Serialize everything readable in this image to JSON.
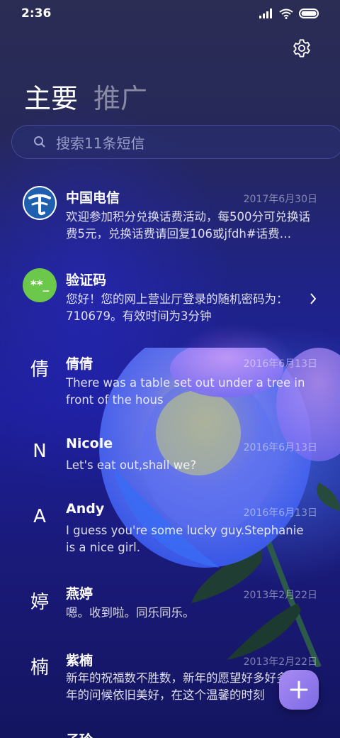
{
  "status_bar": {
    "time": "2:36"
  },
  "tabs": {
    "primary": "主要",
    "promotions": "推广"
  },
  "search": {
    "placeholder": "搜索11条短信"
  },
  "conversations": [
    {
      "sender": "中国电信",
      "date": "2017年6月30日",
      "preview": "欢迎参加积分兑换话费活动，每500分可兑换话费5元，兑换话费请回复106或jfdh#话费…",
      "avatar": "china-telecom-logo-icon"
    },
    {
      "sender": "验证码",
      "date": "",
      "preview": "您好！您的网上营业厅登录的随机密码为：710679。有效时间为3分钟",
      "avatar_text": "**_"
    },
    {
      "sender": "倩倩",
      "date": "2016年6月13日",
      "preview": "There was a table set out under a tree in front of the hous",
      "avatar_text": "倩"
    },
    {
      "sender": "Nicole",
      "date": "2016年6月13日",
      "preview": "Let's eat out,shall we?",
      "avatar_text": "N"
    },
    {
      "sender": "Andy",
      "date": "2016年6月13日",
      "preview": "I guess you're some lucky guy.Stephanie is a nice girl.",
      "avatar_text": "A"
    },
    {
      "sender": "燕婷",
      "date": "2013年2月22日",
      "preview": "嗯。收到啦。同乐同乐。",
      "avatar_text": "婷"
    },
    {
      "sender": "紫楠",
      "date": "2013年2月22日",
      "preview": "新年的祝福数不胜数，新年的愿望好多好多，新年的问候依旧美好，在这个温馨的时刻",
      "avatar_text": "楠"
    },
    {
      "sender": "子玲",
      "date": "",
      "preview": "",
      "avatar_text": ""
    }
  ],
  "colors": {
    "verification_avatar": "#6cc84a",
    "fab_accent": "#9a82ee",
    "telecom_blue": "#1e5fb0"
  }
}
